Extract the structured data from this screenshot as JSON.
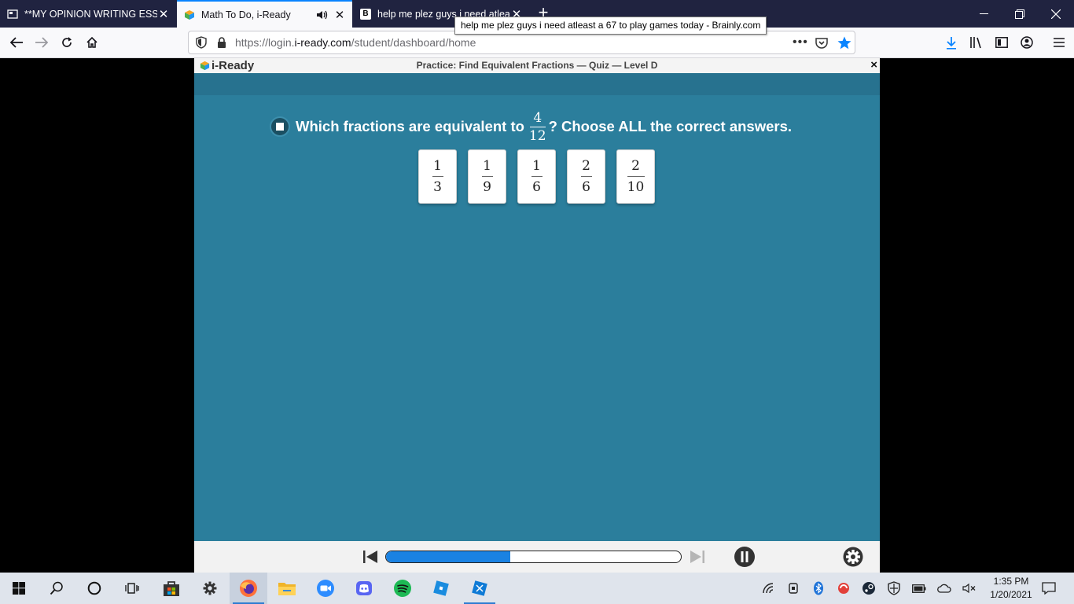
{
  "browser": {
    "tabs": [
      {
        "title": "**MY OPINION WRITING ESSAY",
        "active": false
      },
      {
        "title": "Math To Do, i-Ready",
        "active": true
      },
      {
        "title": "help me plez guys i need atleast a 67 to play games today - Brainly.com",
        "active": false
      }
    ],
    "tooltip": "help me plez guys i need atleast a 67 to play games today - Brainly.com",
    "url_prefix": "https://login.",
    "url_domain": "i-ready.com",
    "url_path": "/student/dashboard/home"
  },
  "app": {
    "logo_text": "i-Ready",
    "title": "Practice: Find Equivalent Fractions — Quiz — Level D",
    "close_label": "×",
    "question": {
      "before": "Which fractions are equivalent to",
      "fraction": {
        "num": "4",
        "den": "12"
      },
      "after": "? Choose ALL the correct answers."
    },
    "choices": [
      {
        "num": "1",
        "den": "3"
      },
      {
        "num": "1",
        "den": "9"
      },
      {
        "num": "1",
        "den": "6"
      },
      {
        "num": "2",
        "den": "6"
      },
      {
        "num": "2",
        "den": "10"
      }
    ],
    "progress_fraction": 0.42,
    "colors": {
      "background": "#2b7e9c",
      "progress": "#1a82e2"
    }
  },
  "taskbar": {
    "clock_time": "1:35 PM",
    "clock_date": "1/20/2021"
  }
}
